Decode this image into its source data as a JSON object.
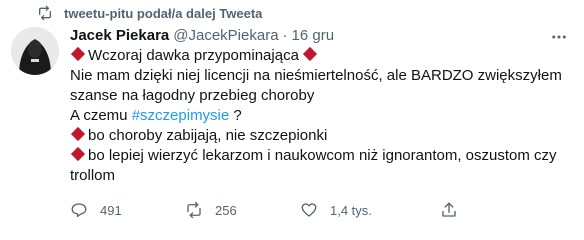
{
  "retweet": {
    "text": "tweetu-pitu podał/a dalej Tweeta"
  },
  "tweet": {
    "author_name": "Jacek Piekara",
    "author_handle": "@JacekPiekara",
    "separator": "·",
    "time": "16 gru",
    "lines": [
      "Wczoraj dawka przypominająca",
      "Nie mam dzięki niej licencji na nieśmiertelność, ale BARDZO zwiększyłem",
      "szanse na łagodny przebieg choroby",
      "A czemu",
      "#szczepimysie",
      "?",
      "bo choroby zabijają, nie szczepionki",
      "bo lepiej wierzyć lekarzom i naukowcom niż ignorantom, oszustom czy",
      "trollom"
    ]
  },
  "actions": {
    "reply_count": "491",
    "retweet_count": "256",
    "like_count": "1,4 tys."
  },
  "colors": {
    "accent": "#1d9bf0",
    "text": "#0f1419",
    "muted": "#536471",
    "diamond": "#c0182d"
  },
  "icons": [
    "retweet-icon",
    "more-icon",
    "reply-icon",
    "like-icon",
    "share-icon",
    "red-diamond-icon"
  ]
}
